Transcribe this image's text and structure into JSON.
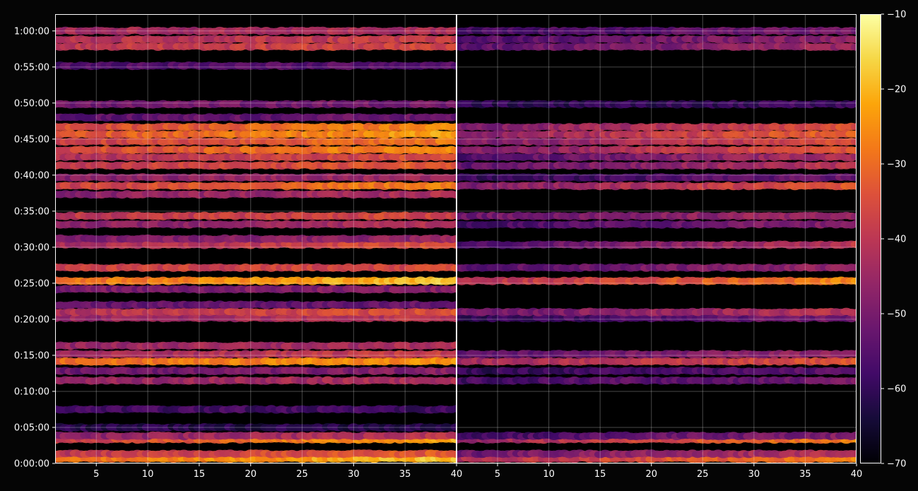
{
  "chart_data": {
    "type": "heatmap",
    "panels": [
      {
        "name": "",
        "x_ticks": [
          5,
          10,
          15,
          20,
          25,
          30,
          35,
          40
        ],
        "xlim": [
          1,
          40
        ],
        "bands": [
          {
            "y": "0:00:40",
            "v": -30,
            "slope": 0.3
          },
          {
            "y": "0:01:20",
            "v": -40,
            "slope": 0.2
          },
          {
            "y": "0:03:20",
            "v": -38,
            "slope": 0.45
          },
          {
            "y": "0:03:50",
            "v": -48,
            "slope": 0.2
          },
          {
            "y": "0:05:00",
            "v": -62,
            "slope": 0.0
          },
          {
            "y": "0:07:30",
            "v": -58,
            "slope": 0.0
          },
          {
            "y": "0:11:30",
            "v": -46,
            "slope": 0.1
          },
          {
            "y": "0:12:50",
            "v": -52,
            "slope": 0.1
          },
          {
            "y": "0:14:10",
            "v": -30,
            "slope": 0.15
          },
          {
            "y": "0:15:10",
            "v": -44,
            "slope": 0.15
          },
          {
            "y": "0:16:20",
            "v": -46,
            "slope": 0.1
          },
          {
            "y": "0:20:10",
            "v": -46,
            "slope": 0.15
          },
          {
            "y": "0:21:00",
            "v": -42,
            "slope": 0.2
          },
          {
            "y": "0:22:00",
            "v": -54,
            "slope": 0.05
          },
          {
            "y": "0:24:10",
            "v": -50,
            "slope": 0.05
          },
          {
            "y": "0:25:20",
            "v": -30,
            "slope": 0.3
          },
          {
            "y": "0:27:10",
            "v": -38,
            "slope": 0.05
          },
          {
            "y": "0:30:20",
            "v": -44,
            "slope": 0.25
          },
          {
            "y": "0:31:10",
            "v": -50,
            "slope": 0.1
          },
          {
            "y": "0:33:10",
            "v": -48,
            "slope": 0.15
          },
          {
            "y": "0:34:20",
            "v": -40,
            "slope": 0.1
          },
          {
            "y": "0:37:20",
            "v": -48,
            "slope": 0.15
          },
          {
            "y": "0:38:30",
            "v": -38,
            "slope": 0.3
          },
          {
            "y": "0:39:40",
            "v": -48,
            "slope": 0.1
          },
          {
            "y": "0:41:20",
            "v": -40,
            "slope": 0.2
          },
          {
            "y": "0:42:30",
            "v": -42,
            "slope": 0.2
          },
          {
            "y": "0:43:30",
            "v": -36,
            "slope": 0.3
          },
          {
            "y": "0:44:40",
            "v": -38,
            "slope": 0.25
          },
          {
            "y": "0:45:40",
            "v": -34,
            "slope": 0.3
          },
          {
            "y": "0:46:40",
            "v": -36,
            "slope": 0.25
          },
          {
            "y": "0:48:00",
            "v": -54,
            "slope": 0.05
          },
          {
            "y": "0:49:50",
            "v": -52,
            "slope": 0.05
          },
          {
            "y": "0:55:10",
            "v": -56,
            "slope": 0.05
          },
          {
            "y": "0:57:50",
            "v": -40,
            "slope": 0.1
          },
          {
            "y": "0:58:50",
            "v": -42,
            "slope": 0.1
          },
          {
            "y": "1:00:00",
            "v": -44,
            "slope": 0.05
          }
        ]
      },
      {
        "name": "",
        "x_ticks": [
          5,
          10,
          15,
          20,
          25,
          30,
          35,
          40
        ],
        "xlim": [
          1,
          40
        ],
        "bands": [
          {
            "y": "0:00:40",
            "v": -42,
            "slope": 0.4
          },
          {
            "y": "0:01:20",
            "v": -52,
            "slope": 0.3
          },
          {
            "y": "0:03:20",
            "v": -46,
            "slope": 0.5
          },
          {
            "y": "0:03:50",
            "v": -58,
            "slope": 0.25
          },
          {
            "y": "0:11:30",
            "v": -58,
            "slope": 0.2
          },
          {
            "y": "0:12:50",
            "v": -60,
            "slope": 0.15
          },
          {
            "y": "0:14:10",
            "v": -44,
            "slope": 0.25
          },
          {
            "y": "0:15:10",
            "v": -54,
            "slope": 0.2
          },
          {
            "y": "0:20:10",
            "v": -60,
            "slope": 0.25
          },
          {
            "y": "0:21:00",
            "v": -52,
            "slope": 0.3
          },
          {
            "y": "0:25:20",
            "v": -42,
            "slope": 0.4
          },
          {
            "y": "0:27:10",
            "v": -54,
            "slope": 0.2
          },
          {
            "y": "0:30:20",
            "v": -56,
            "slope": 0.4
          },
          {
            "y": "0:33:10",
            "v": -58,
            "slope": 0.25
          },
          {
            "y": "0:34:20",
            "v": -52,
            "slope": 0.2
          },
          {
            "y": "0:38:30",
            "v": -50,
            "slope": 0.45
          },
          {
            "y": "0:39:40",
            "v": -60,
            "slope": 0.2
          },
          {
            "y": "0:41:20",
            "v": -54,
            "slope": 0.35
          },
          {
            "y": "0:42:30",
            "v": -56,
            "slope": 0.35
          },
          {
            "y": "0:43:30",
            "v": -50,
            "slope": 0.45
          },
          {
            "y": "0:44:40",
            "v": -50,
            "slope": 0.4
          },
          {
            "y": "0:45:40",
            "v": -48,
            "slope": 0.45
          },
          {
            "y": "0:46:40",
            "v": -50,
            "slope": 0.4
          },
          {
            "y": "0:49:50",
            "v": -62,
            "slope": 0.1
          },
          {
            "y": "0:57:50",
            "v": -54,
            "slope": 0.25
          },
          {
            "y": "0:58:50",
            "v": -56,
            "slope": 0.25
          },
          {
            "y": "1:00:00",
            "v": -58,
            "slope": 0.2
          }
        ]
      }
    ],
    "y_ticks": [
      "0:00:00",
      "0:05:00",
      "0:10:00",
      "0:15:00",
      "0:20:00",
      "0:25:00",
      "0:30:00",
      "0:35:00",
      "0:40:00",
      "0:45:00",
      "0:50:00",
      "0:55:00",
      "1:00:00"
    ],
    "ylim": [
      "0:00:00",
      "1:02:20"
    ],
    "grid": true,
    "colorbar": {
      "colormap": "inferno",
      "range": [
        -70,
        -10
      ],
      "ticks": [
        "−70",
        "−60",
        "−50",
        "−40",
        "−30",
        "−20",
        "−10"
      ]
    }
  }
}
